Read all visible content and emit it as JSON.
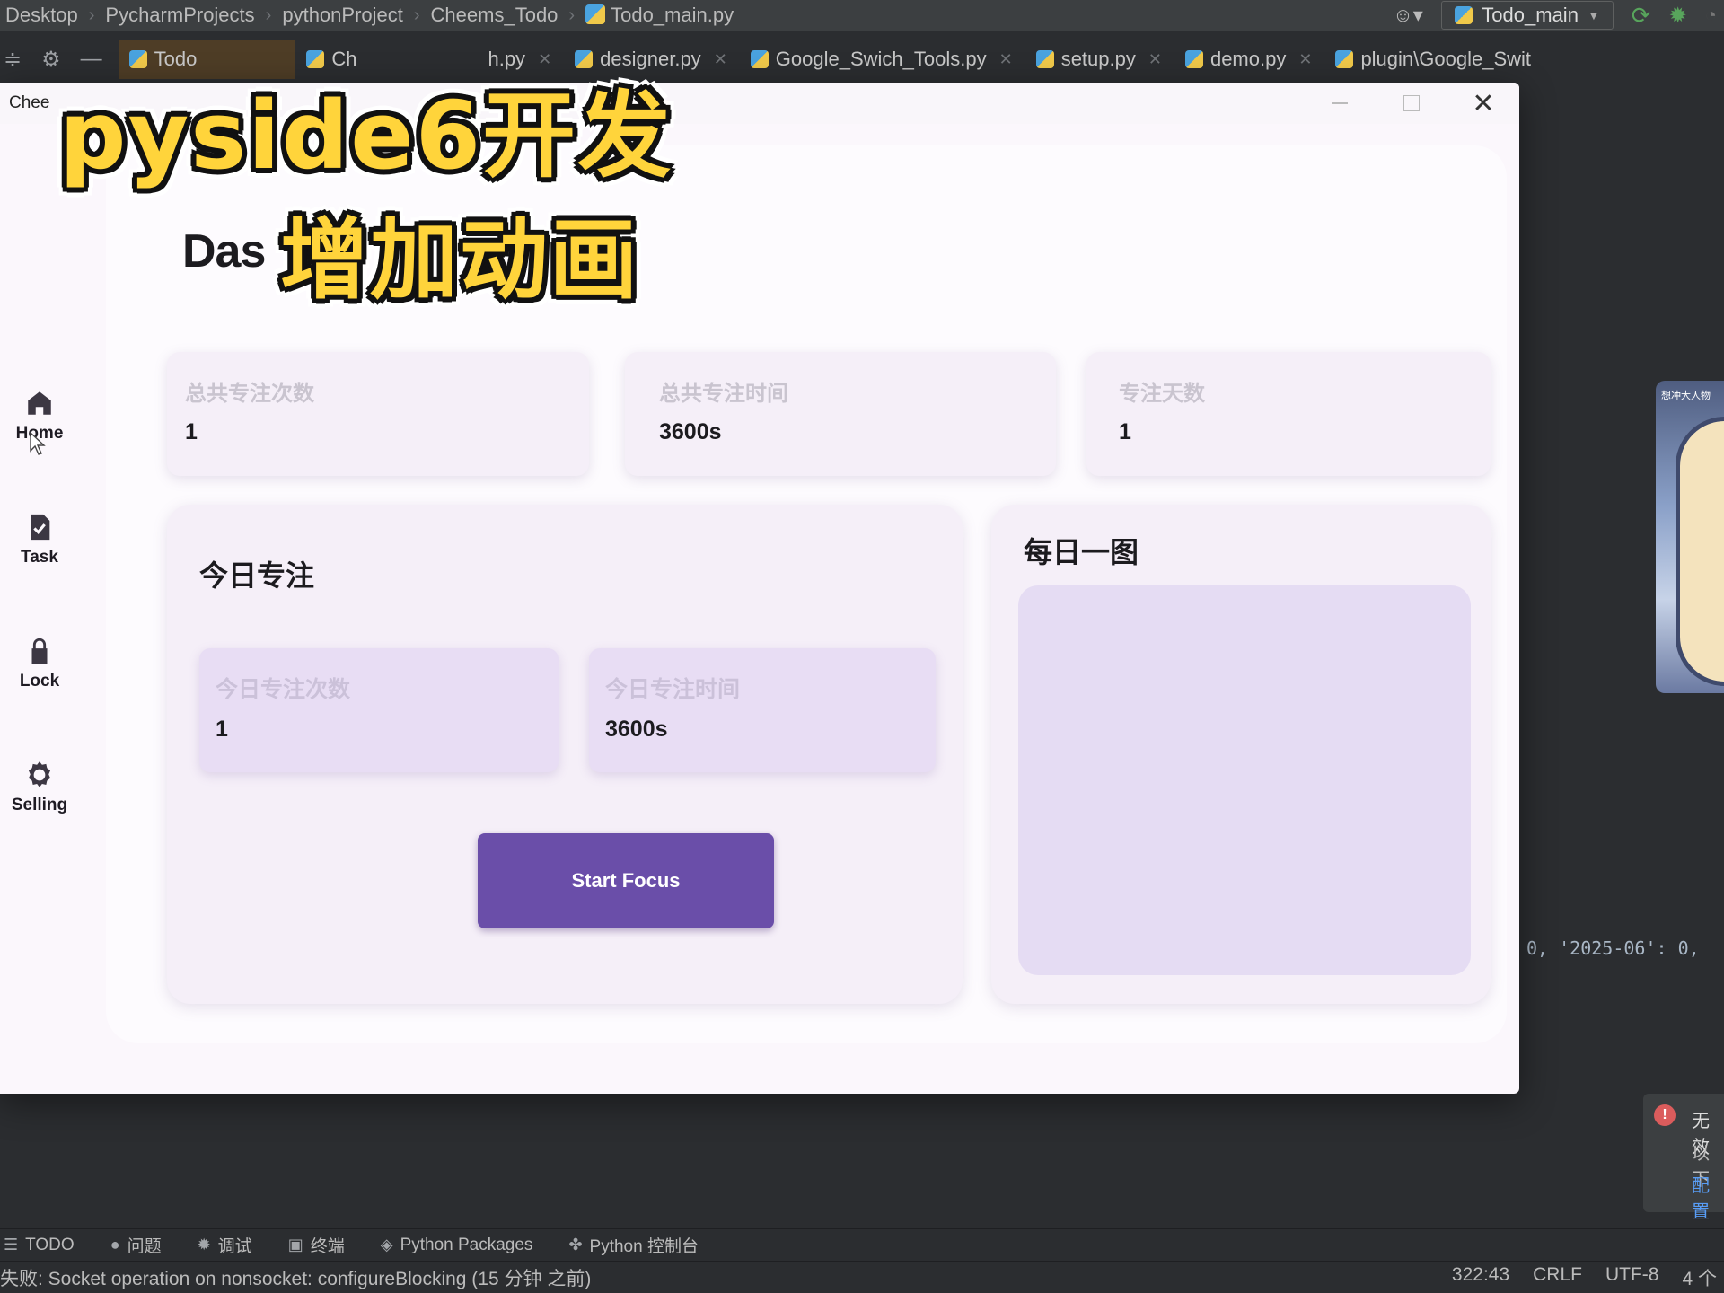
{
  "ide": {
    "breadcrumb": [
      "Desktop",
      "PycharmProjects",
      "pythonProject",
      "Cheems_Todo",
      "Todo_main.py"
    ],
    "run_config": "Todo_main",
    "tabs": [
      {
        "label": "Todo_main.py",
        "shown": "Todo",
        "active": true
      },
      {
        "label": "Ch",
        "shown": "Ch"
      },
      {
        "label": "h.py",
        "shown": "h.py"
      },
      {
        "label": "designer.py",
        "shown": "designer.py"
      },
      {
        "label": "Google_Swich_Tools.py",
        "shown": "Google_Swich_Tools.py"
      },
      {
        "label": "setup.py",
        "shown": "setup.py"
      },
      {
        "label": "demo.py",
        "shown": "demo.py"
      },
      {
        "label": "plugin\\Google_Swit",
        "shown": "plugin\\Google_Swit"
      }
    ],
    "code_fragment": "0, '2025-06': 0,",
    "side_thumb_caption": "想冲大人物",
    "notification": {
      "line1": "无效",
      "line2": "以下",
      "line3": "配置"
    },
    "bottom_tools": [
      "TODO",
      "问题",
      "调试",
      "终端",
      "Python Packages",
      "Python 控制台"
    ],
    "status_message": "失败: Socket operation on nonsocket: configureBlocking (15 分钟 之前)",
    "status_right": [
      "322:43",
      "CRLF",
      "UTF-8",
      "4 个"
    ]
  },
  "app": {
    "window_title": "Chee",
    "sidebar": [
      {
        "label": "Home",
        "icon": "home-icon"
      },
      {
        "label": "Task",
        "icon": "task-icon"
      },
      {
        "label": "Lock",
        "icon": "lock-icon"
      },
      {
        "label": "Selling",
        "icon": "gear-icon"
      }
    ],
    "dashboard_title": "Das",
    "stats": [
      {
        "label": "总共专注次数",
        "value": "1"
      },
      {
        "label": "总共专注时间",
        "value": "3600s"
      },
      {
        "label": "专注天数",
        "value": "1"
      }
    ],
    "today": {
      "title": "今日专注",
      "count_label": "今日专注次数",
      "count_value": "1",
      "time_label": "今日专注时间",
      "time_value": "3600s",
      "button": "Start Focus"
    },
    "daily": {
      "title": "每日一图"
    }
  },
  "overlay": {
    "line1": "pyside6开发",
    "line2": "增加动画"
  },
  "colors": {
    "accent": "#6a4ea9",
    "card": "#f5eff8",
    "subcard": "#e8ddf4",
    "caption": "#ffd43b"
  }
}
